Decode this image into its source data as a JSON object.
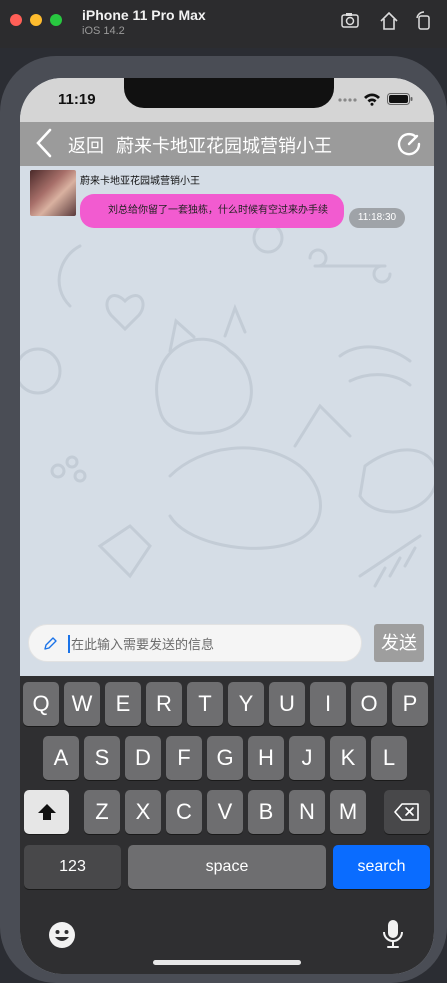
{
  "simulator": {
    "device_name": "iPhone 11 Pro Max",
    "os_version": "iOS 14.2"
  },
  "status_bar": {
    "time": "11:19"
  },
  "nav": {
    "back_label": "返回",
    "title": "蔚来卡地亚花园城营销小王"
  },
  "chat": {
    "messages": [
      {
        "sender": "蔚来卡地亚花园城营销小王",
        "text": "刘总给你留了一套独栋，什么时候有空过来办手续",
        "time": "11:18:30"
      }
    ]
  },
  "input": {
    "placeholder": "在此输入需要发送的信息",
    "send_label": "发送"
  },
  "keyboard": {
    "row1": [
      "Q",
      "W",
      "E",
      "R",
      "T",
      "Y",
      "U",
      "I",
      "O",
      "P"
    ],
    "row2": [
      "A",
      "S",
      "D",
      "F",
      "G",
      "H",
      "J",
      "K",
      "L"
    ],
    "row3": [
      "Z",
      "X",
      "C",
      "V",
      "B",
      "N",
      "M"
    ],
    "numbers_label": "123",
    "space_label": "space",
    "search_label": "search"
  },
  "colors": {
    "bubble": "#f25bd0",
    "navbar": "#9b9b9b",
    "search_key": "#0a6cff"
  }
}
